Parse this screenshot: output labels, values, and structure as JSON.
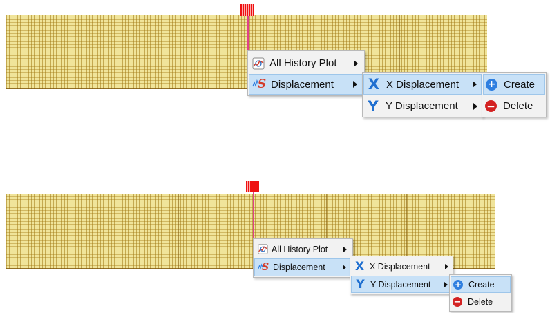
{
  "panels": [
    {
      "history_menu": {
        "all_history_plot_label": "All History Plot",
        "displacement_label": "Displacement"
      },
      "displacement_submenu": {
        "x_label": "X Displacement",
        "y_label": "Y Displacement",
        "highlighted": "X Displacement"
      },
      "action_submenu": {
        "create_label": "Create",
        "delete_label": "Delete",
        "highlighted": "Create"
      }
    },
    {
      "history_menu": {
        "all_history_plot_label": "All History Plot",
        "displacement_label": "Displacement"
      },
      "displacement_submenu": {
        "x_label": "X Displacement",
        "y_label": "Y Displacement",
        "highlighted": "Y Displacement"
      },
      "action_submenu": {
        "create_label": "Create",
        "delete_label": "Delete",
        "highlighted": "Create"
      }
    }
  ],
  "icons": {
    "all_history_plot": "history-plot-icon",
    "displacement": "displacement-s-icon",
    "x_displacement": "x-letter-icon",
    "y_displacement": "y-letter-icon",
    "create": "plus-circle-icon",
    "delete": "minus-circle-icon",
    "submenu": "chevron-right-icon"
  },
  "colors": {
    "mesh": "#f0e49a",
    "load_marker": "#ee1111",
    "line_marker": "#e0408a",
    "menu_bg": "#f2f2f2",
    "highlight": "#c8e1f7",
    "x_glyph": "#1f6fd0",
    "create_icon": "#2f7fe0",
    "delete_icon": "#d32222"
  }
}
